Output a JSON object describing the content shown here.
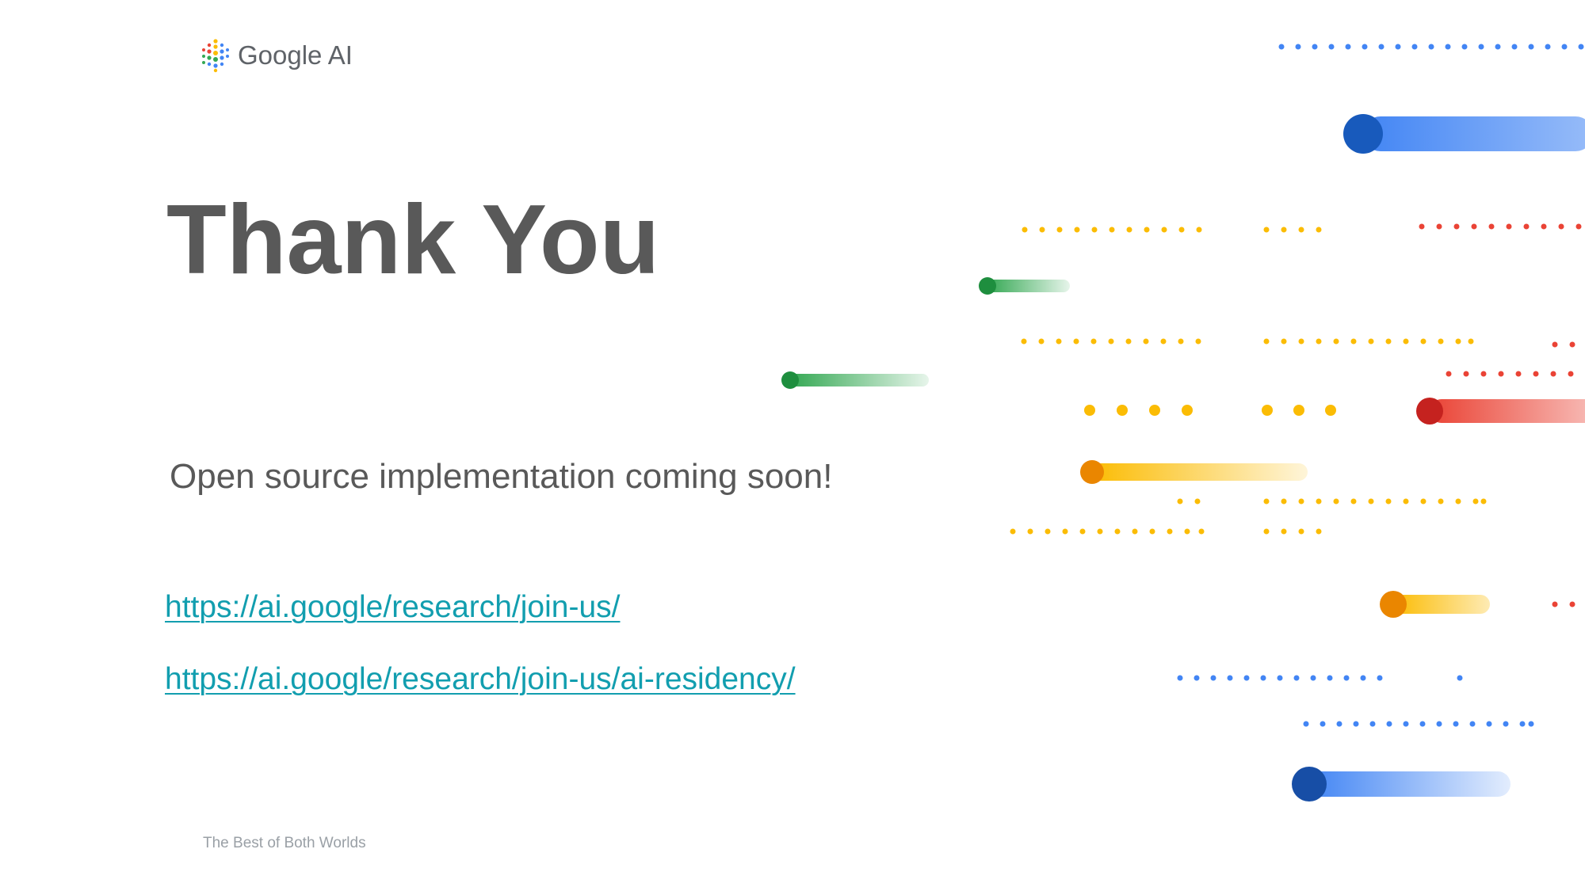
{
  "logo": {
    "text": "Google AI",
    "icon": "google-ai-dots-icon"
  },
  "slide": {
    "title": "Thank You",
    "subtitle": "Open source implementation coming soon!",
    "links": [
      "https://ai.google/research/join-us/",
      "https://ai.google/research/join-us/ai-residency/"
    ],
    "footer": "The Best of Both Worlds"
  },
  "colors": {
    "title": "#595959",
    "link": "#129eaf",
    "google_blue": "#4285f4",
    "google_blue_dark": "#185abc",
    "google_green": "#1e8e3e",
    "google_yellow": "#fbbc04",
    "google_orange": "#ea8600",
    "google_red": "#d93025",
    "footer": "#9aa0a6"
  }
}
